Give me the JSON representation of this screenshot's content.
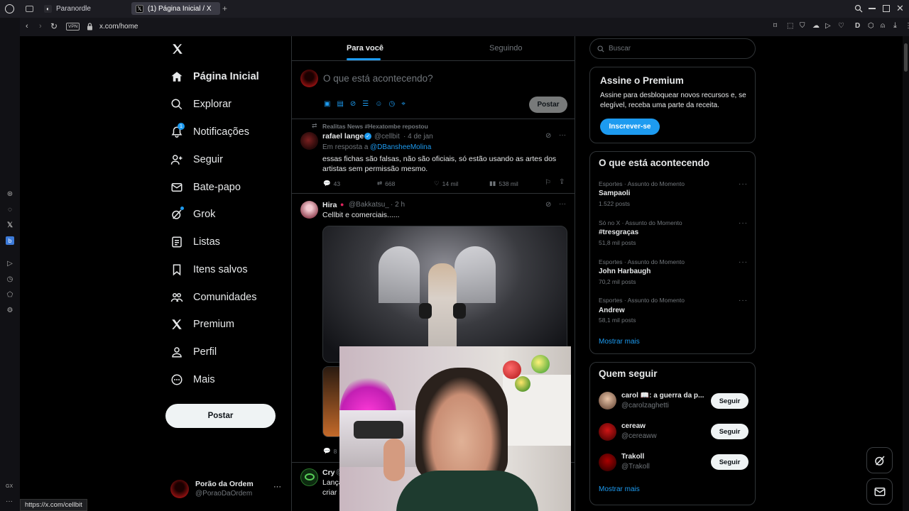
{
  "browser": {
    "tabs": [
      {
        "label": "Paranordle"
      },
      {
        "label": "(1) Página Inicial / X"
      }
    ],
    "new_tab": "+",
    "vpn_label": "VPN",
    "url": "x.com/home",
    "status_url": "https://x.com/cellbit",
    "gx_label": "GX"
  },
  "nav": {
    "items": [
      {
        "label": "Página Inicial",
        "icon": "home-icon"
      },
      {
        "label": "Explorar",
        "icon": "search-icon"
      },
      {
        "label": "Notificações",
        "icon": "bell-icon",
        "badge": "1"
      },
      {
        "label": "Seguir",
        "icon": "add-user-icon"
      },
      {
        "label": "Bate-papo",
        "icon": "mail-icon"
      },
      {
        "label": "Grok",
        "icon": "grok-icon"
      },
      {
        "label": "Listas",
        "icon": "list-icon"
      },
      {
        "label": "Itens salvos",
        "icon": "bookmark-icon"
      },
      {
        "label": "Comunidades",
        "icon": "communities-icon"
      },
      {
        "label": "Premium",
        "icon": "x-icon"
      },
      {
        "label": "Perfil",
        "icon": "person-icon"
      },
      {
        "label": "Mais",
        "icon": "more-circle-icon"
      }
    ],
    "post_button": "Postar",
    "account": {
      "name": "Porão da Ordem",
      "handle": "@PoraoDaOrdem"
    }
  },
  "timeline": {
    "tabs": [
      "Para você",
      "Seguindo"
    ],
    "compose_placeholder": "O que está acontecendo?",
    "compose_button": "Postar",
    "posts": [
      {
        "repost_note": "Realitas News #Hexatombe repostou",
        "name": "rafael lange",
        "handle": "@cellbit",
        "time": "· 4 de jan",
        "reply_prefix": "Em resposta a",
        "reply_to": "@DBansheeMolina",
        "text": "essas fichas são falsas, não são oficiais, só estão usando as artes dos artistas sem permissão mesmo.",
        "replies": "43",
        "reposts": "668",
        "likes": "14 mil",
        "views": "538 mil"
      },
      {
        "name": "Hira",
        "handle": "@Bakkatsu_",
        "time": "· 2 h",
        "text": "Cellbit e comerciais......",
        "replies": "8"
      },
      {
        "name": "Cry",
        "handle": "@",
        "text_line1": "Lança",
        "text_line2": "criar s"
      }
    ]
  },
  "right": {
    "search_placeholder": "Buscar",
    "premium": {
      "title": "Assine o Premium",
      "body": "Assine para desbloquear novos recursos e, se elegível, receba uma parte da receita.",
      "button": "Inscrever-se"
    },
    "trends": {
      "title": "O que está acontecendo",
      "items": [
        {
          "meta": "Esportes · Assunto do Momento",
          "name": "Sampaoli",
          "posts": "1.522 posts"
        },
        {
          "meta": "Só no X · Assunto do Momento",
          "name": "#tresgraças",
          "posts": "51,8 mil posts"
        },
        {
          "meta": "Esportes · Assunto do Momento",
          "name": "John Harbaugh",
          "posts": "70,2 mil posts"
        },
        {
          "meta": "Esportes · Assunto do Momento",
          "name": "Andrew",
          "posts": "58,1 mil posts"
        }
      ],
      "show_more": "Mostrar mais"
    },
    "who_to_follow": {
      "title": "Quem seguir",
      "items": [
        {
          "name": "carol 📖: a guerra da p...",
          "handle": "@carolzaghetti",
          "button": "Seguir"
        },
        {
          "name": "cereaw",
          "handle": "@cereaww",
          "button": "Seguir"
        },
        {
          "name": "Trakoll",
          "handle": "@Trakoll",
          "button": "Seguir"
        }
      ],
      "show_more": "Mostrar mais"
    }
  },
  "colors": {
    "accent": "#1d9bf0",
    "background": "#000000",
    "border": "#2f3336",
    "muted": "#71767b"
  }
}
